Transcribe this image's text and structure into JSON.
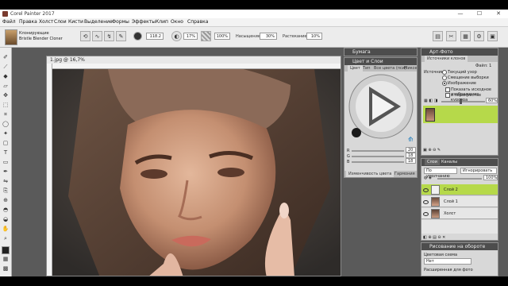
{
  "window": {
    "title": "Corel Painter 2017",
    "controls": [
      "—",
      "☐",
      "✕"
    ]
  },
  "menu": [
    "Файл",
    "Правка",
    "Холст",
    "Слои",
    "Кисти",
    "Выделение",
    "Формы",
    "Эффекты",
    "Клип",
    "Окно",
    "Справка"
  ],
  "brush": {
    "category": "Клонирующие",
    "variant": "Bristle Blender Cloner"
  },
  "options": {
    "size": "118.2",
    "opacity": "17%",
    "grain": "100%",
    "saturation_label": "Насыщение:",
    "saturation": "30%",
    "blend_label": "Растекание:",
    "blend": "10%"
  },
  "document": {
    "tab_title": "1.jpg @ 16,7%"
  },
  "panels": {
    "paper": {
      "title": "Бумага"
    },
    "color": {
      "title": "Цвет и Слои",
      "tabs": [
        "Цвет",
        "Тип",
        "Все цвета (пси)",
        "Миксер"
      ],
      "rgb": [
        "20",
        "18",
        "18"
      ],
      "footer_tabs": [
        "Изменчивость цвета",
        "Гармония"
      ]
    },
    "art": {
      "title": "Арт-Фото",
      "subtitle": "Источники клонов",
      "file": "Файл: 1",
      "label_source": "Источник:",
      "options": [
        "Текущий узор",
        "Смещение выборки",
        "Изображение"
      ],
      "checks": [
        "Показать исходное изображение",
        "в перекрестье курсора"
      ],
      "opacity": "60%"
    },
    "layers": {
      "title": "Слои",
      "tab2": "Каналы",
      "composite_mode": "По умолчанию",
      "ignore_mode": "Игнорировать",
      "opacity": "100%",
      "items": [
        {
          "name": "Слой 2",
          "selected": true
        },
        {
          "name": "Слой 1",
          "selected": false
        },
        {
          "name": "Холст",
          "selected": false
        }
      ]
    },
    "paint": {
      "title": "Рисование на обороте",
      "label1": "Цветовая схема",
      "value1": "Нет",
      "label2": "Расширенная для фото"
    }
  },
  "colors": {
    "accent_green": "#b6d94a",
    "panel_head": "#4d4d4d"
  }
}
